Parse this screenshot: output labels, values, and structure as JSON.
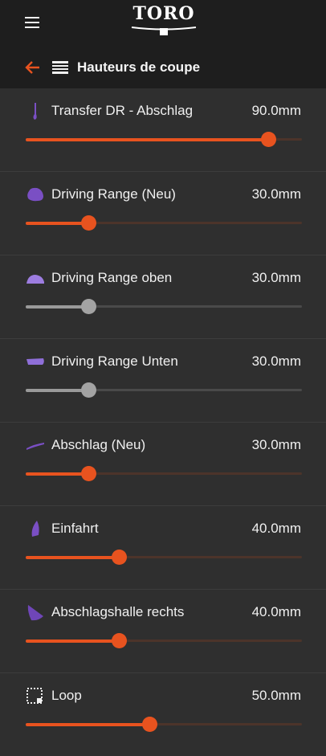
{
  "app": {
    "logo_text": "TORO"
  },
  "header": {
    "title": "Hauteurs de coupe"
  },
  "colors": {
    "accent": "#e8531f",
    "disabled": "#9a9a9a",
    "icon_purple": "#7a4fc4",
    "icon_lavender": "#9d7de0"
  },
  "areas": [
    {
      "name": "Transfer DR - Abschlag",
      "value": "90.0mm",
      "level": 0.88,
      "enabled": true,
      "icon": "pin-shape-icon"
    },
    {
      "name": "Driving Range (Neu)",
      "value": "30.0mm",
      "level": 0.23,
      "enabled": true,
      "icon": "blob-shape-icon"
    },
    {
      "name": "Driving Range oben",
      "value": "30.0mm",
      "level": 0.23,
      "enabled": false,
      "icon": "dome-shape-icon"
    },
    {
      "name": "Driving Range Unten",
      "value": "30.0mm",
      "level": 0.23,
      "enabled": false,
      "icon": "slab-shape-icon"
    },
    {
      "name": "Abschlag (Neu)",
      "value": "30.0mm",
      "level": 0.23,
      "enabled": true,
      "icon": "stroke-shape-icon"
    },
    {
      "name": "Einfahrt",
      "value": "40.0mm",
      "level": 0.34,
      "enabled": true,
      "icon": "leaf-shape-icon"
    },
    {
      "name": "Abschlagshalle rechts",
      "value": "40.0mm",
      "level": 0.34,
      "enabled": true,
      "icon": "wedge-shape-icon"
    },
    {
      "name": "Loop",
      "value": "50.0mm",
      "level": 0.45,
      "enabled": true,
      "icon": "dotted-square-icon"
    }
  ]
}
